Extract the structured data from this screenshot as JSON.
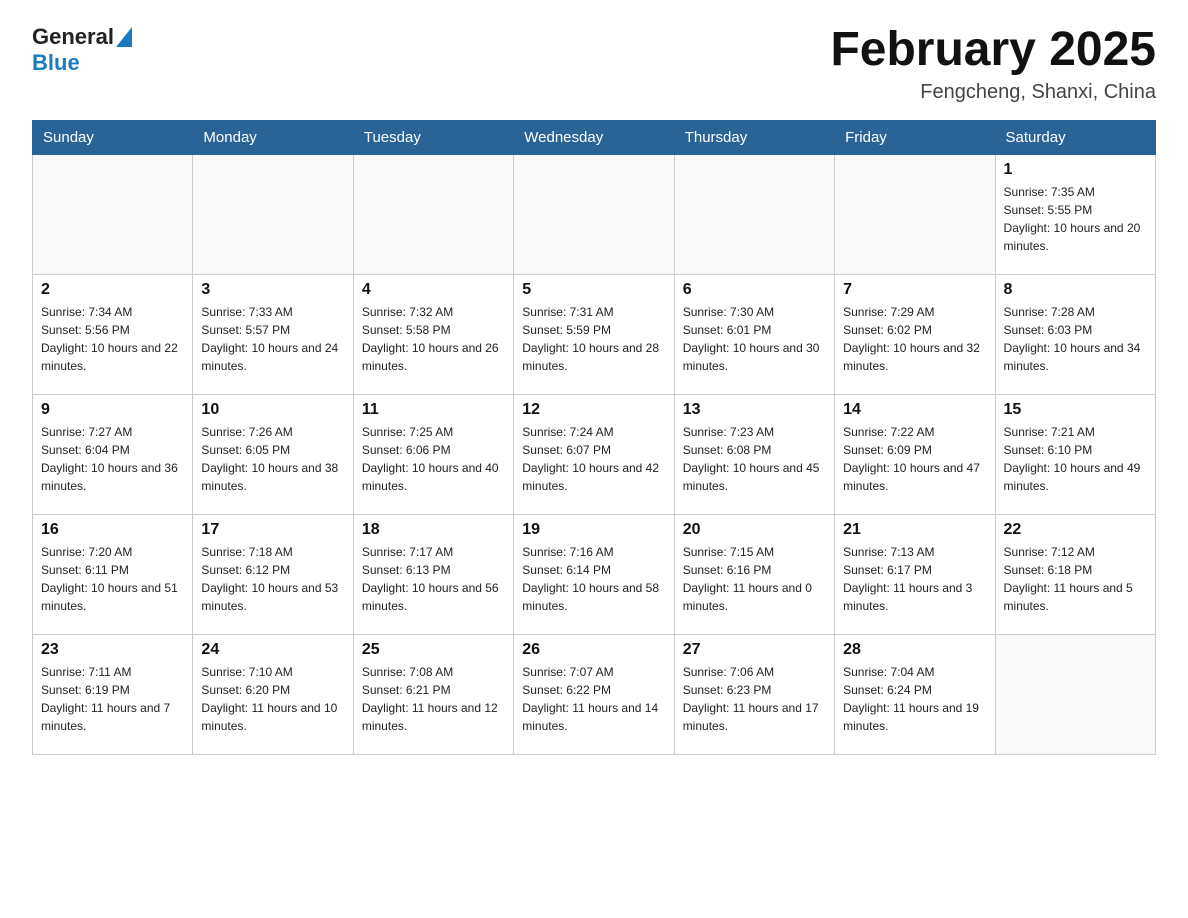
{
  "header": {
    "logo_general": "General",
    "logo_blue": "Blue",
    "month_title": "February 2025",
    "location": "Fengcheng, Shanxi, China"
  },
  "weekdays": [
    "Sunday",
    "Monday",
    "Tuesday",
    "Wednesday",
    "Thursday",
    "Friday",
    "Saturday"
  ],
  "weeks": [
    [
      {
        "day": "",
        "sunrise": "",
        "sunset": "",
        "daylight": ""
      },
      {
        "day": "",
        "sunrise": "",
        "sunset": "",
        "daylight": ""
      },
      {
        "day": "",
        "sunrise": "",
        "sunset": "",
        "daylight": ""
      },
      {
        "day": "",
        "sunrise": "",
        "sunset": "",
        "daylight": ""
      },
      {
        "day": "",
        "sunrise": "",
        "sunset": "",
        "daylight": ""
      },
      {
        "day": "",
        "sunrise": "",
        "sunset": "",
        "daylight": ""
      },
      {
        "day": "1",
        "sunrise": "Sunrise: 7:35 AM",
        "sunset": "Sunset: 5:55 PM",
        "daylight": "Daylight: 10 hours and 20 minutes."
      }
    ],
    [
      {
        "day": "2",
        "sunrise": "Sunrise: 7:34 AM",
        "sunset": "Sunset: 5:56 PM",
        "daylight": "Daylight: 10 hours and 22 minutes."
      },
      {
        "day": "3",
        "sunrise": "Sunrise: 7:33 AM",
        "sunset": "Sunset: 5:57 PM",
        "daylight": "Daylight: 10 hours and 24 minutes."
      },
      {
        "day": "4",
        "sunrise": "Sunrise: 7:32 AM",
        "sunset": "Sunset: 5:58 PM",
        "daylight": "Daylight: 10 hours and 26 minutes."
      },
      {
        "day": "5",
        "sunrise": "Sunrise: 7:31 AM",
        "sunset": "Sunset: 5:59 PM",
        "daylight": "Daylight: 10 hours and 28 minutes."
      },
      {
        "day": "6",
        "sunrise": "Sunrise: 7:30 AM",
        "sunset": "Sunset: 6:01 PM",
        "daylight": "Daylight: 10 hours and 30 minutes."
      },
      {
        "day": "7",
        "sunrise": "Sunrise: 7:29 AM",
        "sunset": "Sunset: 6:02 PM",
        "daylight": "Daylight: 10 hours and 32 minutes."
      },
      {
        "day": "8",
        "sunrise": "Sunrise: 7:28 AM",
        "sunset": "Sunset: 6:03 PM",
        "daylight": "Daylight: 10 hours and 34 minutes."
      }
    ],
    [
      {
        "day": "9",
        "sunrise": "Sunrise: 7:27 AM",
        "sunset": "Sunset: 6:04 PM",
        "daylight": "Daylight: 10 hours and 36 minutes."
      },
      {
        "day": "10",
        "sunrise": "Sunrise: 7:26 AM",
        "sunset": "Sunset: 6:05 PM",
        "daylight": "Daylight: 10 hours and 38 minutes."
      },
      {
        "day": "11",
        "sunrise": "Sunrise: 7:25 AM",
        "sunset": "Sunset: 6:06 PM",
        "daylight": "Daylight: 10 hours and 40 minutes."
      },
      {
        "day": "12",
        "sunrise": "Sunrise: 7:24 AM",
        "sunset": "Sunset: 6:07 PM",
        "daylight": "Daylight: 10 hours and 42 minutes."
      },
      {
        "day": "13",
        "sunrise": "Sunrise: 7:23 AM",
        "sunset": "Sunset: 6:08 PM",
        "daylight": "Daylight: 10 hours and 45 minutes."
      },
      {
        "day": "14",
        "sunrise": "Sunrise: 7:22 AM",
        "sunset": "Sunset: 6:09 PM",
        "daylight": "Daylight: 10 hours and 47 minutes."
      },
      {
        "day": "15",
        "sunrise": "Sunrise: 7:21 AM",
        "sunset": "Sunset: 6:10 PM",
        "daylight": "Daylight: 10 hours and 49 minutes."
      }
    ],
    [
      {
        "day": "16",
        "sunrise": "Sunrise: 7:20 AM",
        "sunset": "Sunset: 6:11 PM",
        "daylight": "Daylight: 10 hours and 51 minutes."
      },
      {
        "day": "17",
        "sunrise": "Sunrise: 7:18 AM",
        "sunset": "Sunset: 6:12 PM",
        "daylight": "Daylight: 10 hours and 53 minutes."
      },
      {
        "day": "18",
        "sunrise": "Sunrise: 7:17 AM",
        "sunset": "Sunset: 6:13 PM",
        "daylight": "Daylight: 10 hours and 56 minutes."
      },
      {
        "day": "19",
        "sunrise": "Sunrise: 7:16 AM",
        "sunset": "Sunset: 6:14 PM",
        "daylight": "Daylight: 10 hours and 58 minutes."
      },
      {
        "day": "20",
        "sunrise": "Sunrise: 7:15 AM",
        "sunset": "Sunset: 6:16 PM",
        "daylight": "Daylight: 11 hours and 0 minutes."
      },
      {
        "day": "21",
        "sunrise": "Sunrise: 7:13 AM",
        "sunset": "Sunset: 6:17 PM",
        "daylight": "Daylight: 11 hours and 3 minutes."
      },
      {
        "day": "22",
        "sunrise": "Sunrise: 7:12 AM",
        "sunset": "Sunset: 6:18 PM",
        "daylight": "Daylight: 11 hours and 5 minutes."
      }
    ],
    [
      {
        "day": "23",
        "sunrise": "Sunrise: 7:11 AM",
        "sunset": "Sunset: 6:19 PM",
        "daylight": "Daylight: 11 hours and 7 minutes."
      },
      {
        "day": "24",
        "sunrise": "Sunrise: 7:10 AM",
        "sunset": "Sunset: 6:20 PM",
        "daylight": "Daylight: 11 hours and 10 minutes."
      },
      {
        "day": "25",
        "sunrise": "Sunrise: 7:08 AM",
        "sunset": "Sunset: 6:21 PM",
        "daylight": "Daylight: 11 hours and 12 minutes."
      },
      {
        "day": "26",
        "sunrise": "Sunrise: 7:07 AM",
        "sunset": "Sunset: 6:22 PM",
        "daylight": "Daylight: 11 hours and 14 minutes."
      },
      {
        "day": "27",
        "sunrise": "Sunrise: 7:06 AM",
        "sunset": "Sunset: 6:23 PM",
        "daylight": "Daylight: 11 hours and 17 minutes."
      },
      {
        "day": "28",
        "sunrise": "Sunrise: 7:04 AM",
        "sunset": "Sunset: 6:24 PM",
        "daylight": "Daylight: 11 hours and 19 minutes."
      },
      {
        "day": "",
        "sunrise": "",
        "sunset": "",
        "daylight": ""
      }
    ]
  ]
}
